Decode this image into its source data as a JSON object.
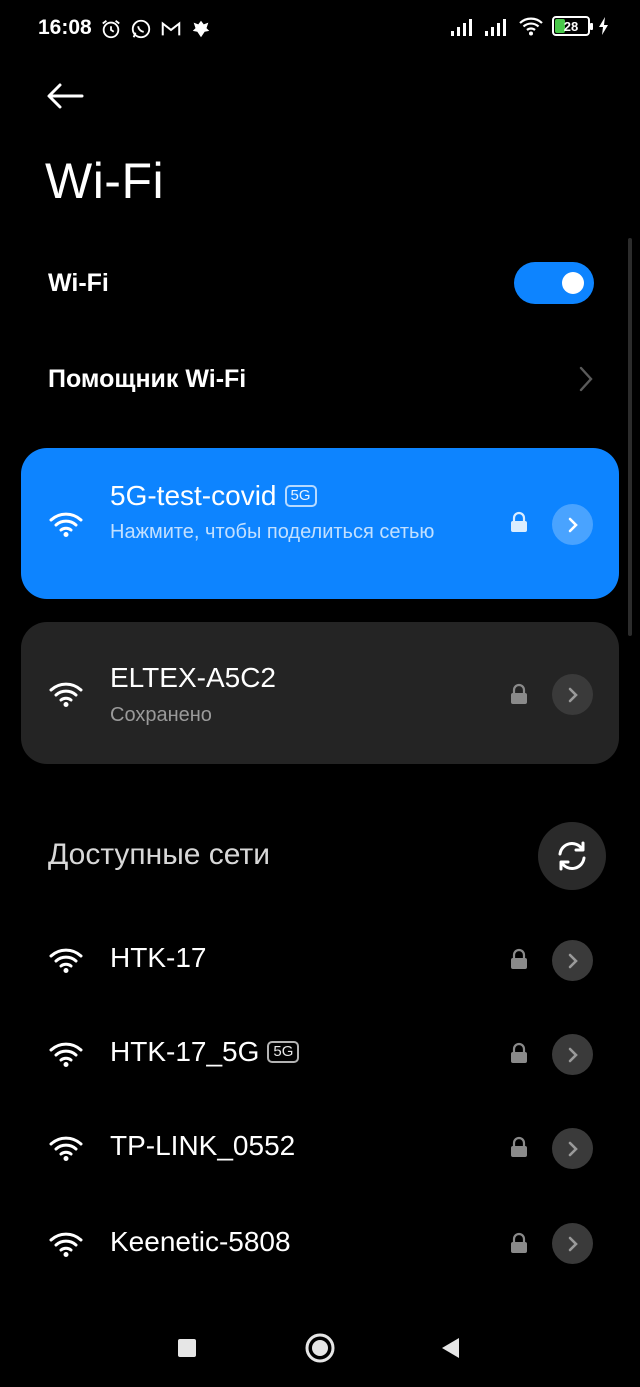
{
  "status_bar": {
    "time": "16:08",
    "battery_level": "28",
    "left_icons": [
      "alarm-icon",
      "whatsapp-icon",
      "gmail-icon",
      "emblem-icon"
    ],
    "right_icons": [
      "signal-icon",
      "signal-icon",
      "wifi-icon",
      "battery-icon",
      "charging-icon"
    ]
  },
  "header": {
    "back_icon": "arrow-left-icon",
    "title": "Wi-Fi"
  },
  "wifi_toggle": {
    "label": "Wi-Fi",
    "enabled": true
  },
  "assistant": {
    "label": "Помощник Wi-Fi"
  },
  "connected_networks": [
    {
      "name": "5G-test-covid",
      "badge": "5G",
      "subtitle": "Нажмите, чтобы поделиться сетью",
      "secured": true,
      "active": true
    },
    {
      "name": "ELTEX-A5C2",
      "subtitle": "Сохранено",
      "secured": true,
      "active": false
    }
  ],
  "available": {
    "title": "Доступные сети",
    "networks": [
      {
        "name": "HTK-17",
        "badge": ""
      },
      {
        "name": "HTK-17_5G",
        "badge": "5G"
      },
      {
        "name": "TP-LINK_0552",
        "badge": ""
      },
      {
        "name": "Keenetic-5808",
        "badge": ""
      }
    ]
  },
  "colors": {
    "accent": "#0d84ff",
    "card": "#242424",
    "background": "#000000"
  },
  "nav_bar": {
    "icons": [
      "recents-square-icon",
      "home-circle-icon",
      "back-triangle-icon"
    ]
  }
}
